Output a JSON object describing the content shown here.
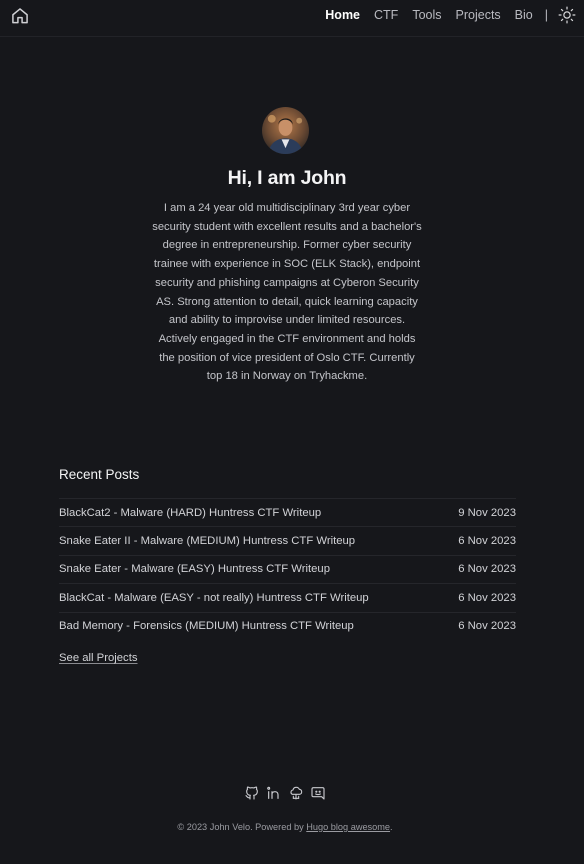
{
  "nav": {
    "items": [
      {
        "label": "Home",
        "active": true
      },
      {
        "label": "CTF",
        "active": false
      },
      {
        "label": "Tools",
        "active": false
      },
      {
        "label": "Projects",
        "active": false
      },
      {
        "label": "Bio",
        "active": false
      }
    ],
    "separator": "|",
    "home_icon": "home-icon",
    "theme_icon": "sun-icon"
  },
  "hero": {
    "title": "Hi, I am John",
    "bio": "I am a 24 year old multidisciplinary 3rd year cyber security student with excellent results and a bachelor's degree in entrepreneurship. Former cyber security trainee with experience in SOC (ELK Stack), endpoint security and phishing campaigns at Cyberon Security AS. Strong attention to detail, quick learning capacity and ability to improvise under limited resources. Actively engaged in the CTF environment and holds the position of vice president of Oslo CTF. Currently top 18 in Norway on Tryhackme."
  },
  "posts": {
    "title": "Recent Posts",
    "items": [
      {
        "title": "BlackCat2 - Malware (HARD) Huntress CTF Writeup",
        "date": "9 Nov 2023"
      },
      {
        "title": "Snake Eater II - Malware (MEDIUM) Huntress CTF Writeup",
        "date": "6 Nov 2023"
      },
      {
        "title": "Snake Eater - Malware (EASY) Huntress CTF Writeup",
        "date": "6 Nov 2023"
      },
      {
        "title": "BlackCat - Malware (EASY - not really) Huntress CTF Writeup",
        "date": "6 Nov 2023"
      },
      {
        "title": "Bad Memory - Forensics (MEDIUM) Huntress CTF Writeup",
        "date": "6 Nov 2023"
      }
    ],
    "see_all": "See all Projects"
  },
  "social": {
    "icons": [
      "github-icon",
      "linkedin-icon",
      "cloud-network-icon",
      "discord-icon"
    ]
  },
  "footer": {
    "prefix": "© 2023 John Velo. Powered by ",
    "link": "Hugo blog awesome",
    "suffix": "."
  },
  "colors": {
    "background": "#16171b",
    "text": "#d8d8da",
    "heading": "#f4f4f5",
    "divider": "#25262b"
  }
}
